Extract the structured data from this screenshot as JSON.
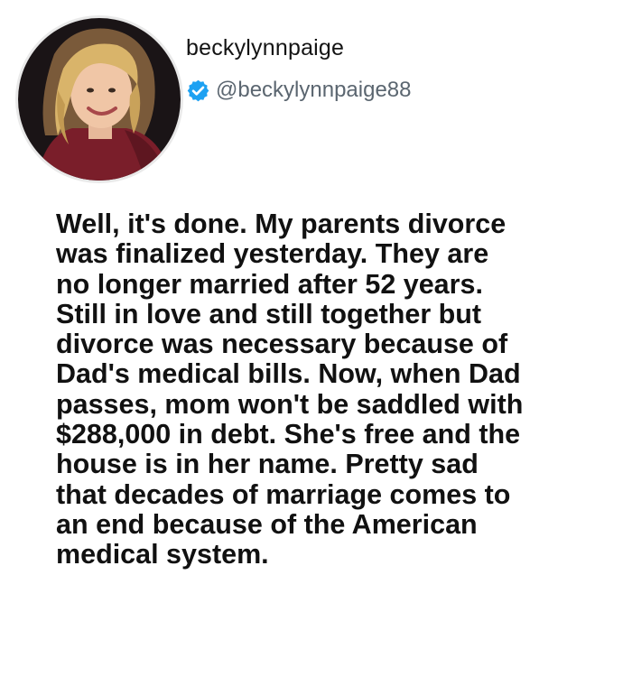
{
  "profile": {
    "display_name": "beckylynnpaige",
    "handle": "@beckylynnpaige88",
    "verified": true,
    "avatar_icon": "profile-photo",
    "verified_icon": "verified-badge-icon",
    "verified_color": "#1da1f2"
  },
  "tweet": {
    "lines": [
      "Well, it's done. My parents divorce",
      "was finalized yesterday. They are",
      "no longer married after 52 years.",
      "Still in love and still together but",
      "divorce was necessary because of",
      "Dad's medical bills. Now, when Dad",
      "passes, mom won't be saddled with",
      "$288,000 in debt. She's free and the",
      "house is in her name. Pretty sad",
      "that decades of marriage comes to",
      "an end because of the American",
      "medical system."
    ]
  }
}
